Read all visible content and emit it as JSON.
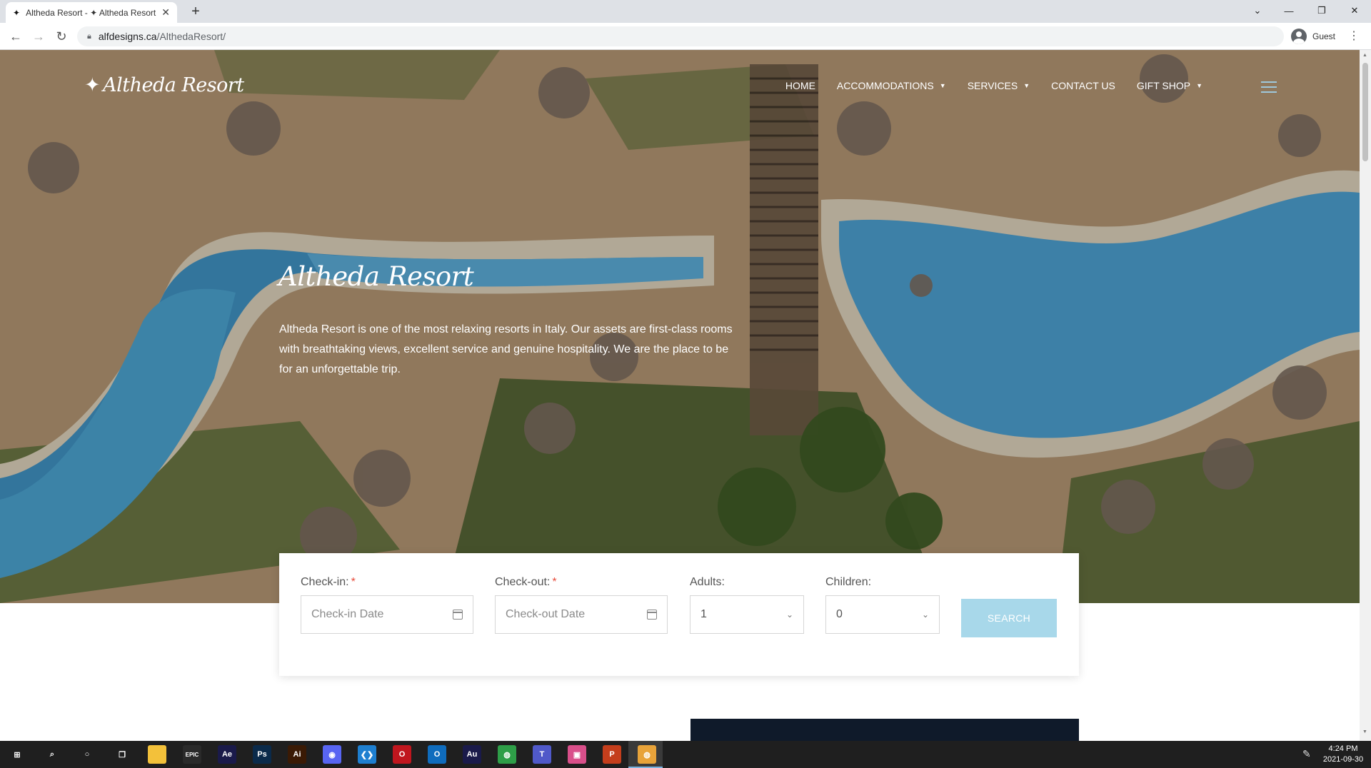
{
  "browser": {
    "tab_title": "Altheda Resort - ✦ Altheda Resort",
    "tab_favicon": "✦",
    "url_host": "alfdesigns.ca",
    "url_path": "/AlthedaResort/",
    "profile_label": "Guest"
  },
  "site": {
    "logo_star": "✦",
    "logo_text": "Altheda Resort",
    "menu": [
      {
        "label": "HOME",
        "has_caret": false
      },
      {
        "label": "ACCOMMODATIONS",
        "has_caret": true
      },
      {
        "label": "SERVICES",
        "has_caret": true
      },
      {
        "label": "CONTACT US",
        "has_caret": false
      },
      {
        "label": "GIFT SHOP",
        "has_caret": true
      }
    ]
  },
  "hero": {
    "title": "Altheda Resort",
    "text": "Altheda Resort is one of the most relaxing resorts in Italy. Our assets are first-class rooms with breathtaking views, excellent service and genuine hospitality. We are the place to be for an unforgettable trip."
  },
  "booking": {
    "checkin_label": "Check-in:",
    "checkin_placeholder": "Check-in Date",
    "checkout_label": "Check-out:",
    "checkout_placeholder": "Check-out Date",
    "required_mark": "*",
    "adults_label": "Adults:",
    "adults_value": "1",
    "children_label": "Children:",
    "children_value": "0",
    "search_label": "SEARCH"
  },
  "taskbar": {
    "time": "4:24 PM",
    "date": "2021-09-30",
    "apps": [
      {
        "name": "windows-start-icon",
        "glyph": "⊞",
        "color": "#1f1f1f"
      },
      {
        "name": "search-icon",
        "glyph": "⌕",
        "color": "#1f1f1f"
      },
      {
        "name": "cortana-icon",
        "glyph": "○",
        "color": "#1f1f1f"
      },
      {
        "name": "task-view-icon",
        "glyph": "❐",
        "color": "#1f1f1f"
      },
      {
        "name": "file-explorer-icon",
        "glyph": "",
        "color": "#f3c13a"
      },
      {
        "name": "epic-games-icon",
        "glyph": "EPIC",
        "color": "#2a2a2a"
      },
      {
        "name": "after-effects-icon",
        "glyph": "Ae",
        "color": "#1a1a4a"
      },
      {
        "name": "photoshop-icon",
        "glyph": "Ps",
        "color": "#0b2a4a"
      },
      {
        "name": "illustrator-icon",
        "glyph": "Ai",
        "color": "#3a1a05"
      },
      {
        "name": "discord-icon",
        "glyph": "◉",
        "color": "#5865f2"
      },
      {
        "name": "vscode-icon",
        "glyph": "❮❯",
        "color": "#1e7fd0"
      },
      {
        "name": "opera-icon",
        "glyph": "O",
        "color": "#c0161e"
      },
      {
        "name": "outlook-icon",
        "glyph": "O",
        "color": "#0f6cbd"
      },
      {
        "name": "audition-icon",
        "glyph": "Au",
        "color": "#1a1a4a"
      },
      {
        "name": "chrome-icon",
        "glyph": "◍",
        "color": "#2e9e48"
      },
      {
        "name": "teams-icon",
        "glyph": "T",
        "color": "#5059c9"
      },
      {
        "name": "photos-icon",
        "glyph": "▣",
        "color": "#d94f8a"
      },
      {
        "name": "powerpoint-icon",
        "glyph": "P",
        "color": "#c43e1c"
      },
      {
        "name": "chrome-active-icon",
        "glyph": "◍",
        "color": "#e8a33a"
      }
    ]
  },
  "colors": {
    "accent": "#a8d8ea",
    "required": "#e74c3c"
  }
}
